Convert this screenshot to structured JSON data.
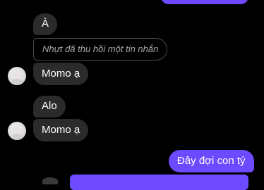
{
  "conversation": {
    "messages": [
      {
        "from": "other",
        "type": "text",
        "text": "À"
      },
      {
        "from": "other",
        "type": "recalled",
        "text": "Nhựt đã thu hồi một tin nhắn"
      },
      {
        "from": "other",
        "type": "text",
        "text": "Momo ạ"
      },
      {
        "from": "other",
        "type": "text",
        "text": "Alo"
      },
      {
        "from": "other",
        "type": "text",
        "text": "Momo ạ"
      },
      {
        "from": "me",
        "type": "text",
        "text": "Đây đợi con tý"
      }
    ]
  },
  "colors": {
    "background": "#000000",
    "received_bubble": "#2b2b2b",
    "sent_bubble": "#6d4aff",
    "recalled_text": "#a8a8a8"
  },
  "icons": {
    "avatar": "contact-avatar"
  }
}
